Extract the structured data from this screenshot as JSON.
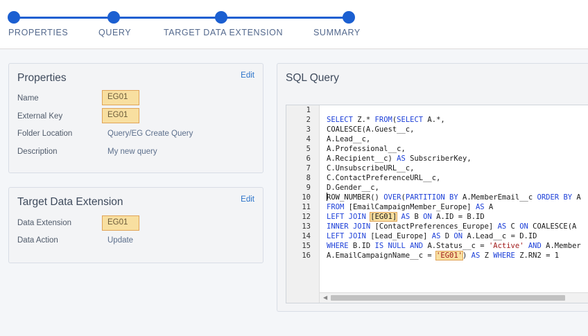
{
  "stepper": {
    "steps": [
      {
        "label": "PROPERTIES"
      },
      {
        "label": "QUERY"
      },
      {
        "label": "TARGET DATA EXTENSION"
      },
      {
        "label": "SUMMARY"
      }
    ],
    "accent_color": "#1b5fd1"
  },
  "properties": {
    "title": "Properties",
    "edit_label": "Edit",
    "fields": [
      {
        "label": "Name",
        "value": "EG01",
        "highlighted": true
      },
      {
        "label": "External Key",
        "value": "EG01",
        "highlighted": true
      },
      {
        "label": "Folder Location",
        "value": "Query/EG Create Query",
        "highlighted": false
      },
      {
        "label": "Description",
        "value": "My new query",
        "highlighted": false
      }
    ]
  },
  "target": {
    "title": "Target Data Extension",
    "edit_label": "Edit",
    "fields": [
      {
        "label": "Data Extension",
        "value": "EG01",
        "highlighted": true
      },
      {
        "label": "Data Action",
        "value": "Update",
        "highlighted": false
      }
    ]
  },
  "sql": {
    "title": "SQL Query",
    "lines": [
      {
        "no": "1",
        "text": ""
      },
      {
        "no": "2",
        "text": "SELECT Z.* FROM(SELECT A.*,"
      },
      {
        "no": "3",
        "text": "COALESCE(A.Guest__c,"
      },
      {
        "no": "4",
        "text": "A.Lead__c,"
      },
      {
        "no": "5",
        "text": "A.Professional__c,"
      },
      {
        "no": "6",
        "text": "A.Recipient__c) AS SubscriberKey,"
      },
      {
        "no": "7",
        "text": "C.UnsubscribeURL__c,"
      },
      {
        "no": "8",
        "text": "C.ContactPreferenceURL__c,"
      },
      {
        "no": "9",
        "text": "D.Gender__c,"
      },
      {
        "no": "10",
        "text": "ROW_NUMBER() OVER(PARTITION BY A.MemberEmail__c ORDER BY A"
      },
      {
        "no": "11",
        "text": "FROM [EmailCampaignMember_Europe] AS A"
      },
      {
        "no": "12",
        "text": "LEFT JOIN [EG01] AS B ON A.ID = B.ID"
      },
      {
        "no": "13",
        "text": "INNER JOIN [ContactPreferences_Europe] AS C ON COALESCE(A"
      },
      {
        "no": "14",
        "text": "LEFT JOIN [Lead_Europe] AS D ON A.Lead__c = D.ID"
      },
      {
        "no": "15",
        "text": "WHERE B.ID IS NULL AND A.Status__c = 'Active' AND A.Member"
      },
      {
        "no": "16",
        "text": "A.EmailCampaignName__c = 'EG01') AS Z WHERE Z.RN2 = 1"
      }
    ]
  },
  "colors": {
    "keyword": "#1c3fd8",
    "string": "#a11b1b",
    "highlight": "#f8dfa0",
    "link": "#2a72c9"
  }
}
